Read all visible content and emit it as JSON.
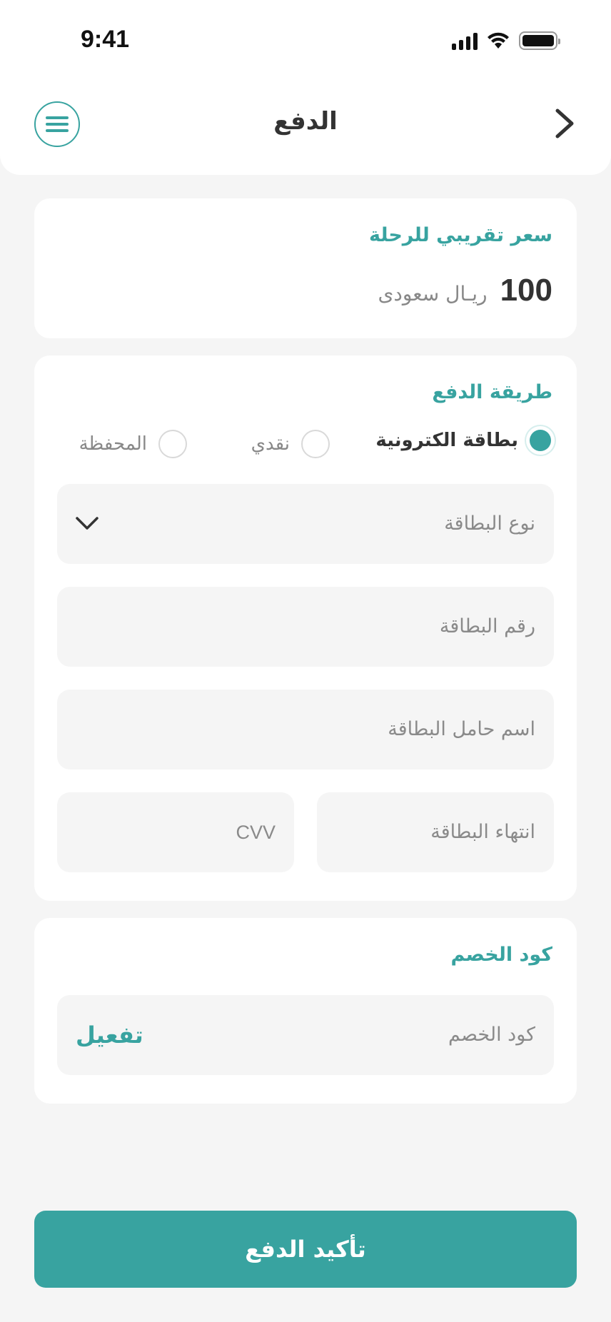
{
  "status_bar": {
    "time": "9:41"
  },
  "header": {
    "title": "الدفع"
  },
  "price_card": {
    "title": "سعر تقريبي للرحلة",
    "value": "100",
    "currency": "ريـال سعودى"
  },
  "payment_method": {
    "title": "طريقة الدفع",
    "options": [
      {
        "label": "بطاقة الكترونية",
        "selected": true
      },
      {
        "label": "نقدي",
        "selected": false
      },
      {
        "label": "المحفظة",
        "selected": false
      }
    ],
    "fields": {
      "card_type": "نوع البطاقة",
      "card_number": "رقم البطاقة",
      "card_holder": "اسم حامل البطاقة",
      "card_expiry": "انتهاء البطاقة",
      "cvv": "CVV"
    }
  },
  "discount": {
    "title": "كود الخصم",
    "placeholder": "كود الخصم",
    "activate_label": "تفعيل"
  },
  "confirm_label": "تأكيد الدفع",
  "colors": {
    "accent": "#38a3a0",
    "background": "#f5f5f5",
    "card": "#ffffff"
  },
  "icons": [
    "menu-icon",
    "chevron-right-icon",
    "chevron-down-icon",
    "signal-icon",
    "wifi-icon",
    "battery-icon"
  ]
}
